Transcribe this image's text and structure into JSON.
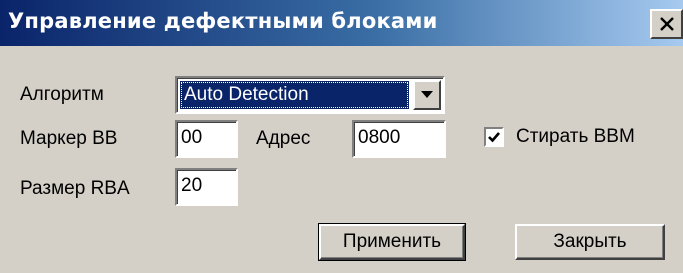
{
  "window": {
    "title": "Управление дефектными блоками"
  },
  "form": {
    "algorithm_label": "Алгоритм",
    "algorithm_value": "Auto Detection",
    "bb_marker_label": "Маркер BB",
    "bb_marker_value": "00",
    "address_label": "Адрес",
    "address_value": "0800",
    "erase_bbm_label": "Стирать BBM",
    "erase_bbm_checked": true,
    "rba_size_label": "Размер RBA",
    "rba_size_value": "20"
  },
  "buttons": {
    "apply_label": "Применить",
    "close_label": "Закрыть"
  },
  "icons": {
    "close": "close-icon",
    "dropdown": "chevron-down-icon",
    "check": "checkmark-icon"
  },
  "colors": {
    "titlebar_start": "#0a246a",
    "titlebar_end": "#a6caf0",
    "face": "#d4d0c8",
    "selection": "#0a246a"
  }
}
